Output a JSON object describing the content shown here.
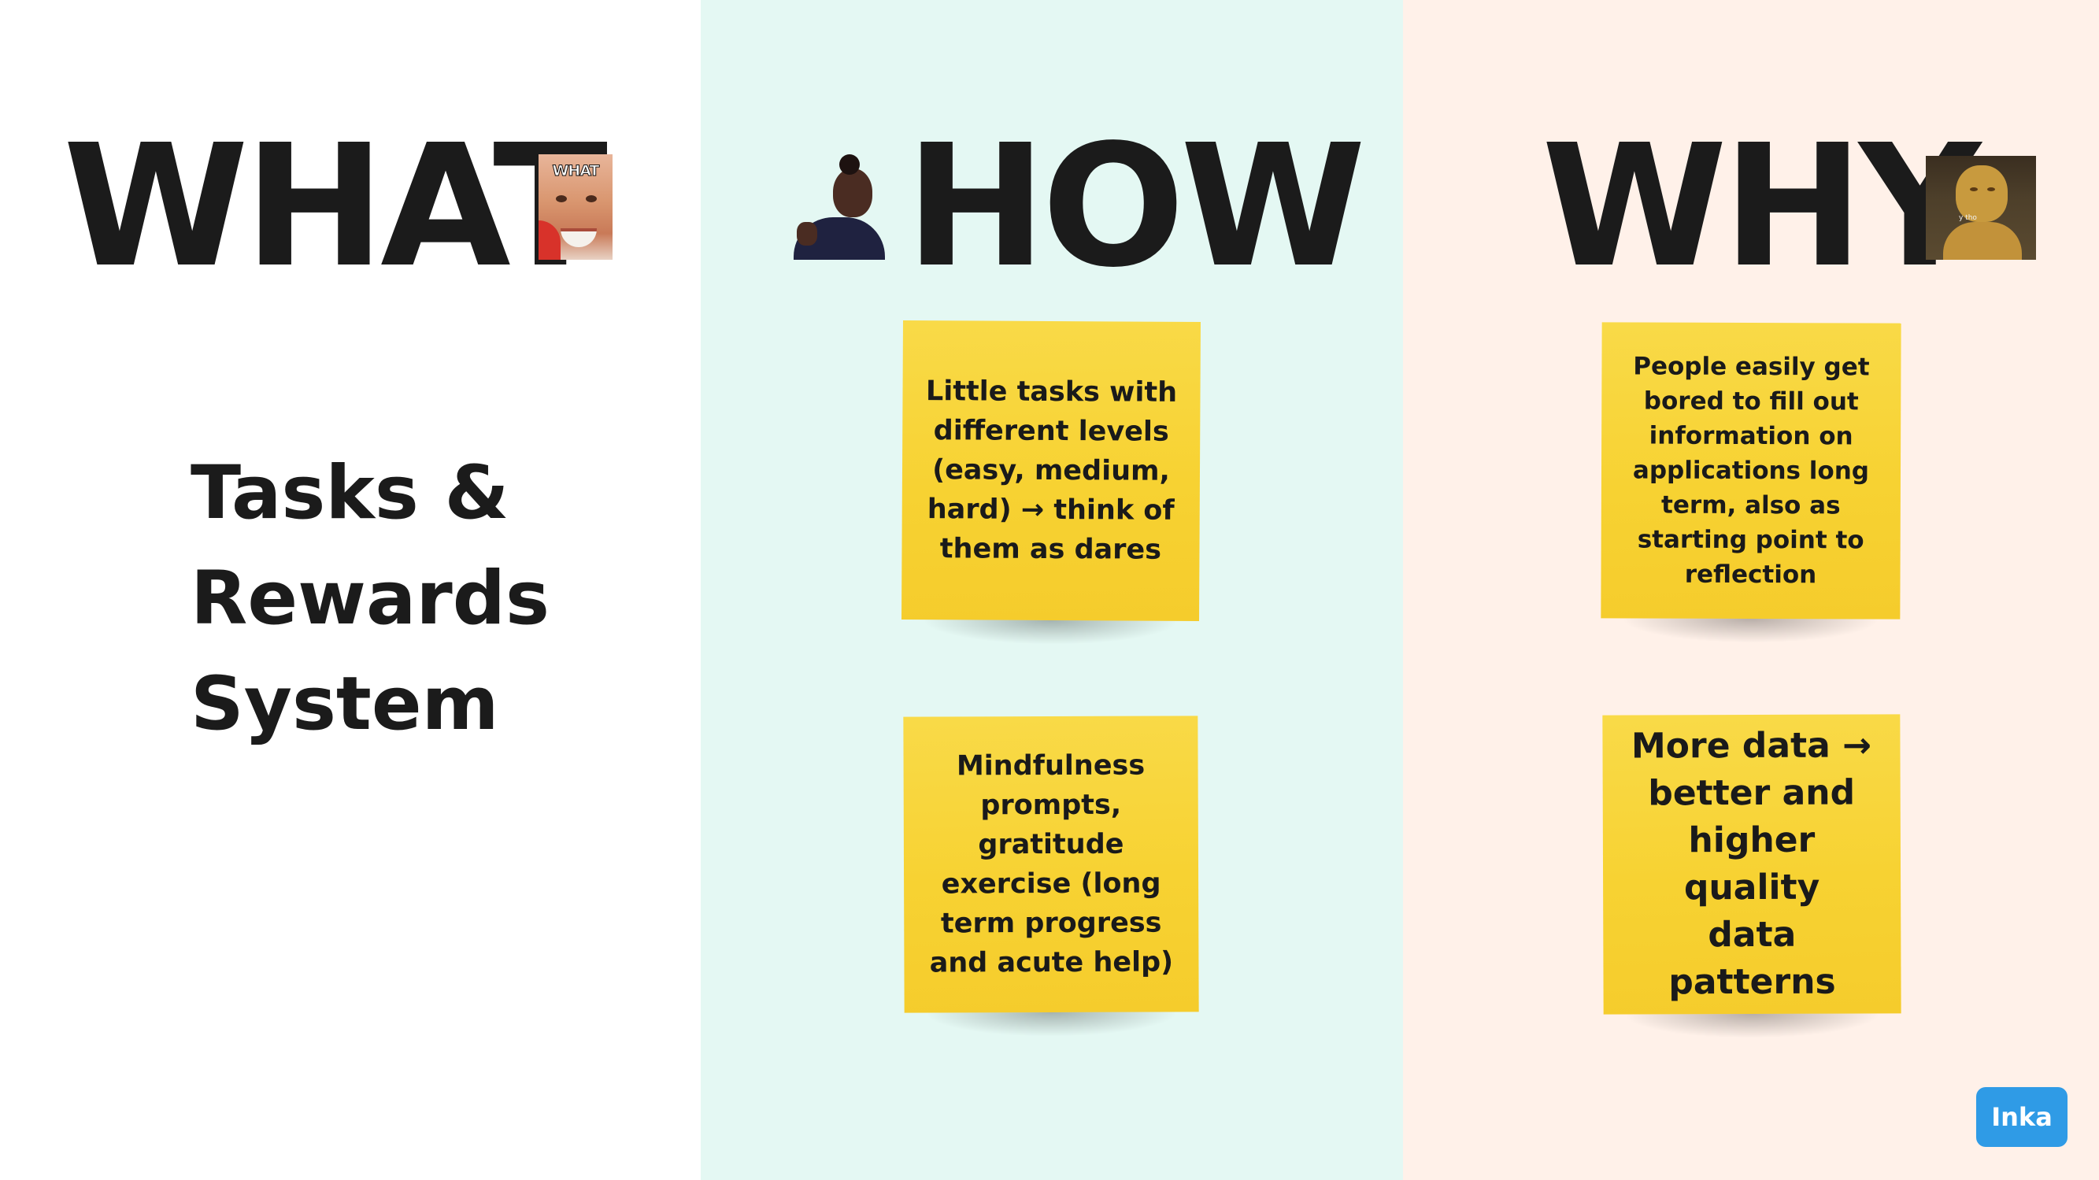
{
  "columns": {
    "what": {
      "heading": "WHAT",
      "sticker_caption": "WHAT",
      "body_lines": [
        "Tasks &",
        "Rewards",
        "System"
      ],
      "background": "#ffffff"
    },
    "how": {
      "heading": "HOW",
      "background": "#e4f8f3",
      "notes": [
        "Little tasks with\ndifferent levels\n(easy, medium,\nhard) → think of\nthem as dares",
        "Mindfulness\nprompts,\ngratitude\nexercise (long\nterm progress\nand acute help)"
      ]
    },
    "why": {
      "heading": "WHY",
      "sticker_caption": "y tho",
      "background": "#fff1e9",
      "notes": [
        "People easily get\nbored to fill out\ninformation on\napplications long\nterm, also as\nstarting point to\nreflection",
        "More data →\nbetter and\nhigher quality\ndata patterns"
      ]
    }
  },
  "note_color": "#f7d232",
  "badge": {
    "label": "Inka",
    "color": "#2f9be6"
  },
  "icons": [
    "what-sticker",
    "how-sticker",
    "why-sticker"
  ]
}
